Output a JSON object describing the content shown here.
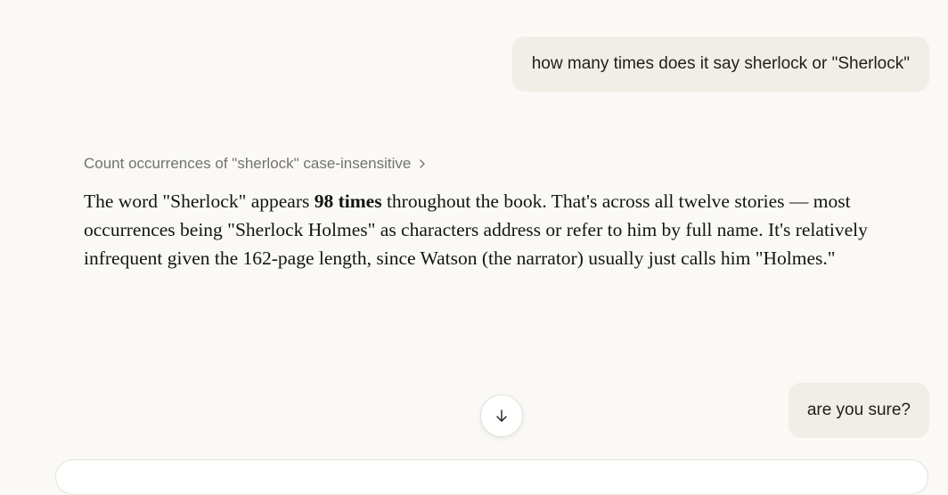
{
  "messages": {
    "user_1": "how many times does it say sherlock or \"Sherlock\"",
    "tool_step": "Count occurrences of \"sherlock\" case-insensitive",
    "answer": {
      "part_1": "The word \"Sherlock\" appears ",
      "bold": "98 times",
      "part_2": " throughout the book. That's across all twelve stories — most occurrences being \"Sherlock Holmes\" as characters address or refer to him by full name. It's relatively infrequent given the 162-page length, since Watson (the narrator) usually just calls him \"Holmes.\""
    },
    "user_2": "are you sure?"
  },
  "icons": {
    "tool_expand": "chevron-right-icon",
    "scroll_down": "arrow-down-icon"
  },
  "colors": {
    "background": "#faf9f5",
    "user_bubble": "#f0eee6",
    "muted_text": "#73726c"
  }
}
